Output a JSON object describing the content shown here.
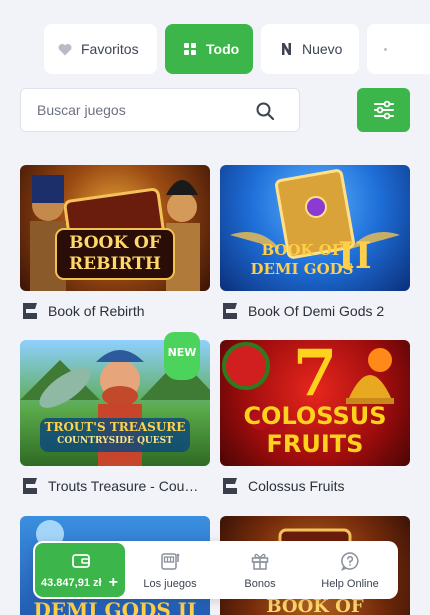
{
  "tabs": [
    {
      "label": "Favoritos",
      "icon": "heart-icon"
    },
    {
      "label": "Todo",
      "icon": "grid-icon",
      "active": true
    },
    {
      "label": "Nuevo",
      "icon": "new-n-icon"
    }
  ],
  "search": {
    "placeholder": "Buscar juegos"
  },
  "colors": {
    "accent": "#3cb64a",
    "background": "#f1f3f8"
  },
  "games": [
    {
      "name": "Book of Rebirth",
      "art_line1": "BOOK OF",
      "art_line2": "REBIRTH"
    },
    {
      "name": "Book Of Demi Gods 2",
      "art_line1": "BOOK OF",
      "art_line2": "DEMI GODS",
      "art_numeral": "II"
    },
    {
      "name": "Trouts Treasure - Countryside Quest",
      "art_line1": "TROUT'S TREASURE",
      "art_line2": "COUNTRYSIDE QUEST",
      "badge": "NEW"
    },
    {
      "name": "Colossus Fruits",
      "art_numeral": "7",
      "art_line1": "COLOSSUS",
      "art_line2": "FRUITS"
    },
    {
      "art_line1": "DEMI GODS II"
    },
    {
      "art_line1": "BOOK OF REBIRTH"
    }
  ],
  "bottom_nav": {
    "balance": "43.847,91 zł",
    "plus": "+",
    "items": [
      {
        "label": "Los juegos",
        "icon": "slot-machine-icon"
      },
      {
        "label": "Bonos",
        "icon": "gift-icon"
      },
      {
        "label": "Help Online",
        "icon": "help-icon"
      }
    ]
  }
}
